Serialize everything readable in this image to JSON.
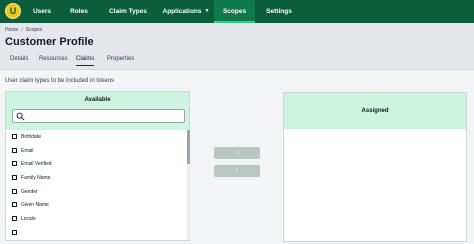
{
  "nav": {
    "logo_letter": "U",
    "items": [
      {
        "label": "Users"
      },
      {
        "label": "Roles"
      },
      {
        "label": "Claim Types"
      },
      {
        "label": "Applications"
      },
      {
        "label": "Scopes"
      },
      {
        "label": "Settings"
      }
    ],
    "active": "Scopes",
    "colors": {
      "bar": "#0b5e3b",
      "active": "#0f7a4e",
      "logo": "#f5c518"
    }
  },
  "breadcrumb": [
    "Home",
    "Scopes"
  ],
  "breadcrumb_separator": "/",
  "page_title": "Customer Profile",
  "tabs": [
    {
      "label": "Details"
    },
    {
      "label": "Resources"
    },
    {
      "label": "Claims"
    },
    {
      "label": "Properties"
    }
  ],
  "active_tab": "Claims",
  "section_label": "User claim types to be included in tokens",
  "available": {
    "title": "Available",
    "search_placeholder": "",
    "items": [
      {
        "label": "Birthdate",
        "checked": false
      },
      {
        "label": "Email",
        "checked": false
      },
      {
        "label": "Email Verified",
        "checked": false
      },
      {
        "label": "Family Name",
        "checked": false
      },
      {
        "label": "Gender",
        "checked": false
      },
      {
        "label": "Given Name",
        "checked": false
      },
      {
        "label": "Locale",
        "checked": false
      }
    ]
  },
  "transfer": {
    "add_label": "›",
    "remove_label": "‹"
  },
  "assigned": {
    "title": "Assigned",
    "items": []
  },
  "colors": {
    "panel_header": "#cdf5dd",
    "transfer_button": "#b8c7bf"
  }
}
